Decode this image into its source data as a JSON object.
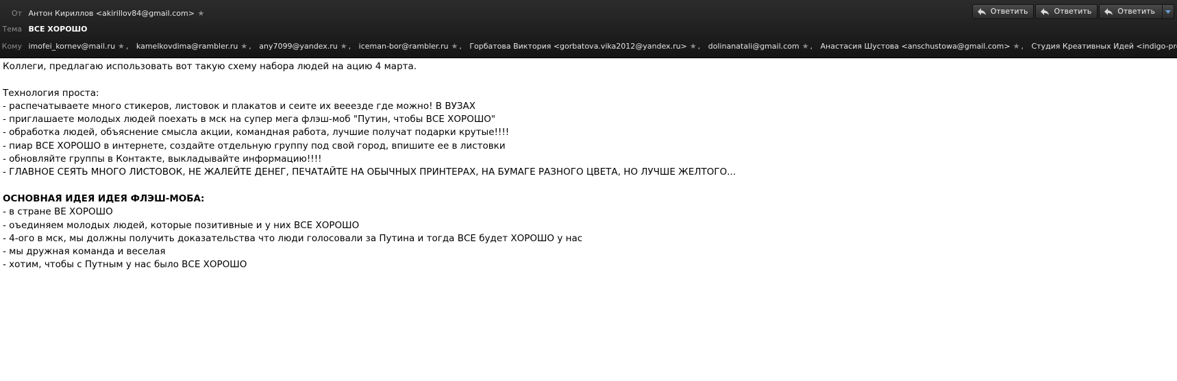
{
  "header": {
    "from_label": "От",
    "from_value": "Антон Кириллов <akirillov84@gmail.com>",
    "subject_label": "Тема",
    "subject_value": "ВСЕ ХОРОШО",
    "to_label": "Кому",
    "recipients": [
      "imofei_kornev@mail.ru",
      "kamelkovdima@rambler.ru",
      "any7099@yandex.ru",
      "iceman-bor@rambler.ru",
      "Горбатова Виктория <gorbatova.vika2012@yandex.ru>",
      "dolinanatali@gmail.com",
      "Анастасия Шустова <anschustowa@gmail.com>",
      "Студия Креативных Идей <indigo-pro@bk.ru>"
    ],
    "separator": ","
  },
  "buttons": {
    "reply_label": "Ответить",
    "reply_all_label": "Ответить",
    "reply_more_label": "Ответить"
  },
  "icons": {
    "star": "star-icon",
    "reply": "reply-arrow-icon",
    "dropdown": "chevron-down-icon"
  },
  "message": {
    "intro": "Коллеги, предлагаю использовать вот такую схему набора людей на ацию 4 марта.",
    "tech_heading": "Технология проста:",
    "tech_items": [
      "- распечатываете много стикеров, листовок и плакатов и сеите их вееезде где можно! В ВУЗАХ",
      "- приглашаете молодых людей поехать в мск на супер мега флэш-моб \"Путин, чтобы ВСЕ ХОРОШО\"",
      "- обработка людей, объяснение смысла акции, командная работа, лучшие получат подарки крутые!!!!",
      "- пиар ВСЕ ХОРОШО в интернете, создайте отдельную группу под свой город, впишите ее в листовки",
      "- обновляйте группы в Контакте, выкладывайте информацию!!!!",
      "- ГЛАВНОЕ СЕЯТЬ МНОГО ЛИСТОВОК, НЕ ЖАЛЕЙТЕ ДЕНЕГ, ПЕЧАТАЙТЕ НА ОБЫЧНЫХ ПРИНТЕРАХ, НА БУМАГЕ РАЗНОГО ЦВЕТА, НО ЛУЧШЕ ЖЕЛТОГО..."
    ],
    "idea_heading": "ОСНОВНАЯ ИДЕЯ ИДЕЯ ФЛЭШ-МОБА:",
    "idea_items": [
      "- в стране ВЕ ХОРОШО",
      "- оъединяем молодых людей, которые позитивные и у них ВСЕ ХОРОШО",
      "- 4-ого в мск, мы должны получить доказательства что люди голосовали за Путина и тогда ВСЕ будет ХОРОШО у нас",
      "- мы дружная команда и веселая",
      "- хотим, чтобы с Путным у нас было ВСЕ ХОРОШО"
    ]
  },
  "colors": {
    "header_bg": "#1f1f1f",
    "header_label": "#8c8c8c",
    "header_text": "#e6e6e6",
    "body_bg": "#ffffff",
    "body_text": "#000000"
  }
}
